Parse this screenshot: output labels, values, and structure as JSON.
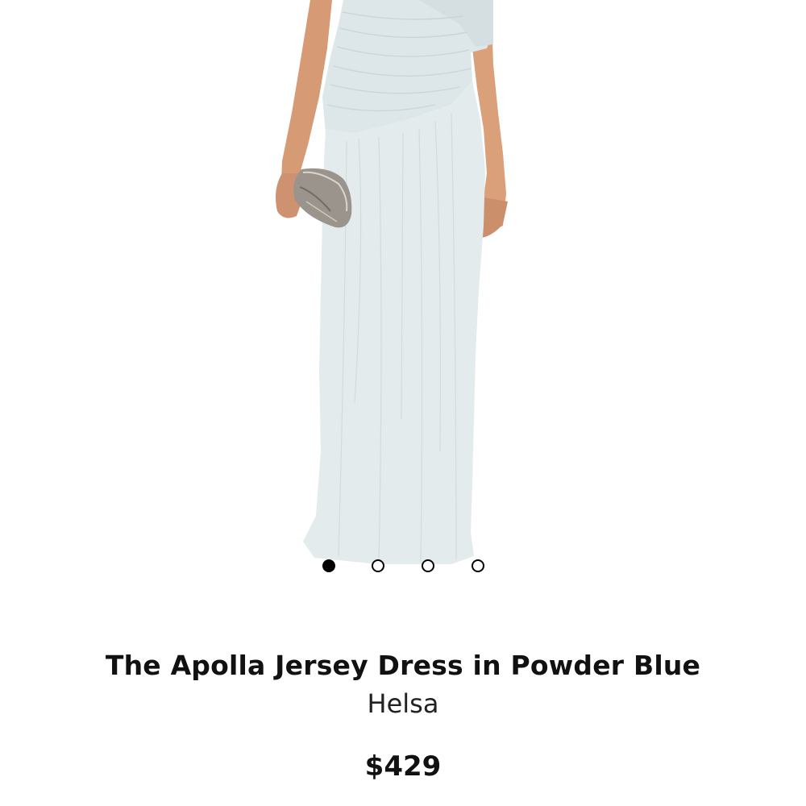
{
  "product": {
    "title": "The Apolla Jersey Dress in Powder Blue",
    "brand": "Helsa",
    "price": "$429"
  },
  "carousel": {
    "total_images": 4,
    "active_index": 0
  },
  "colors": {
    "dress": "#e3ebec",
    "skin": "#d9a07a",
    "clutch": "#9a948c",
    "dot_active": "#000000"
  }
}
